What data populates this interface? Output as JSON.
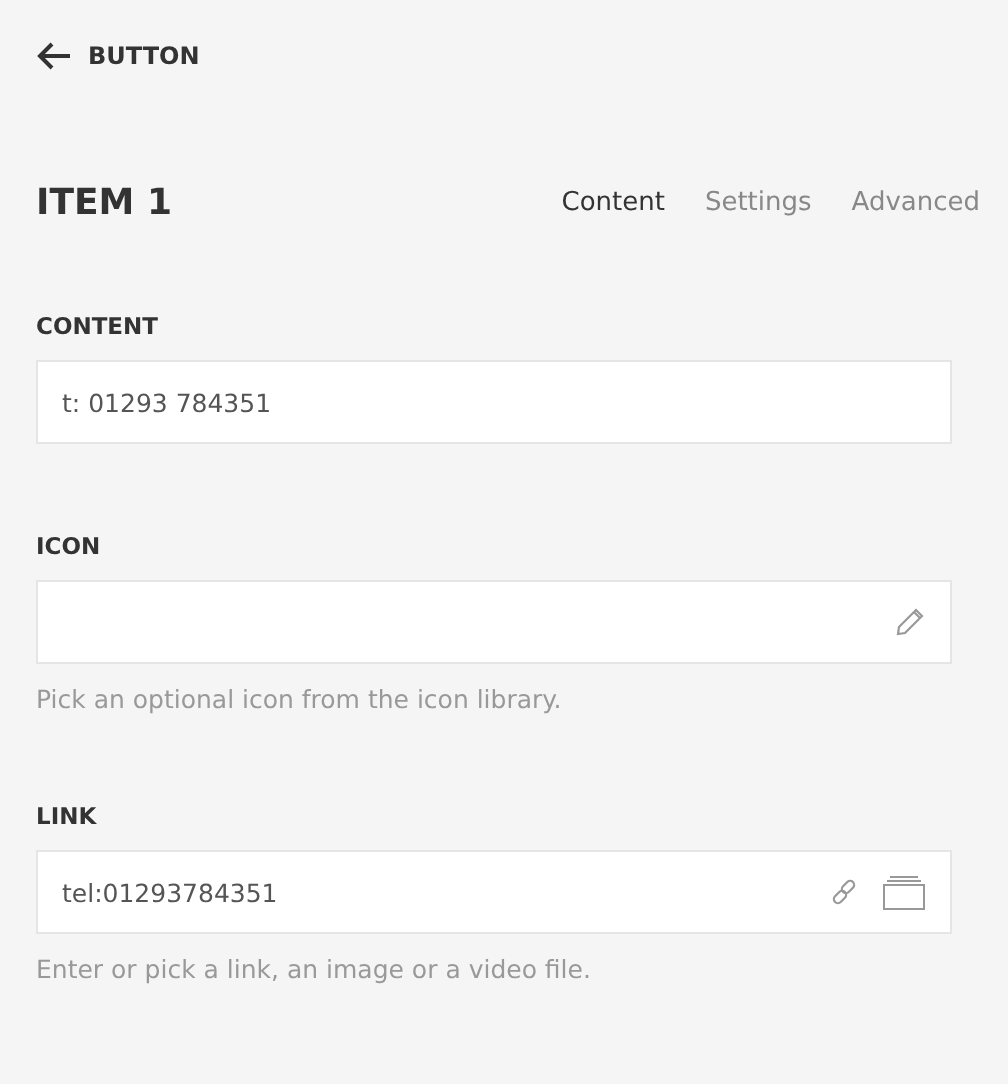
{
  "back": {
    "label": "BUTTON"
  },
  "title": "ITEM 1",
  "tabs": [
    {
      "label": "Content",
      "selected": true
    },
    {
      "label": "Settings",
      "selected": false
    },
    {
      "label": "Advanced",
      "selected": false
    }
  ],
  "fields": [
    {
      "kind": "text",
      "label": "CONTENT",
      "value": "t: 01293 784351"
    },
    {
      "kind": "icon",
      "label": "ICON",
      "help": "Pick an optional icon from the icon library."
    },
    {
      "kind": "link",
      "label": "LINK",
      "value": "tel:01293784351",
      "help": "Enter or pick a link, an image or a video file."
    }
  ]
}
